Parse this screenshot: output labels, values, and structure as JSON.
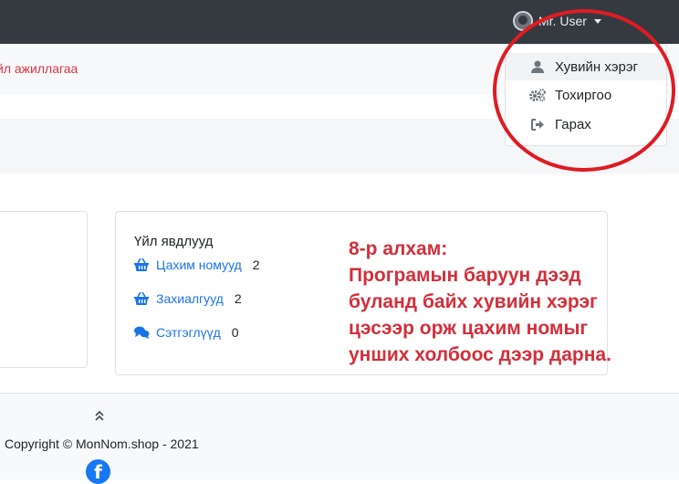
{
  "header": {
    "user_name": "Mr. User"
  },
  "subheader": {
    "link_label": "йл ажиллагаа"
  },
  "user_menu": {
    "items": [
      {
        "label": "Хувийн хэрэг",
        "icon": "user-icon"
      },
      {
        "label": "Тохиргоо",
        "icon": "cogs-icon"
      },
      {
        "label": "Гарах",
        "icon": "sign-out-icon"
      }
    ]
  },
  "activity_card": {
    "title": "Үйл явдлууд",
    "rows": [
      {
        "label": "Цахим номууд",
        "count": "2",
        "icon": "basket-icon"
      },
      {
        "label": "Захиалгууд",
        "count": "2",
        "icon": "basket-icon"
      },
      {
        "label": "Сэтгэглүүд",
        "count": "0",
        "icon": "comments-icon"
      }
    ]
  },
  "annotation": {
    "line1": "8-р алхам:",
    "line2": "Програмын баруун дээд",
    "line3": "буланд байх хувийн хэрэг",
    "line4": "цэсээр орж цахим номыг",
    "line5": "унших холбоос дээр дарна."
  },
  "footer": {
    "copyright": "Copyright © MonNom.shop - 2021",
    "social_icon": "facebook-icon"
  },
  "colors": {
    "topbar": "#343a40",
    "link": "#1a73e8",
    "annotation": "#d32f3a",
    "highlight_circle": "#e01b24"
  }
}
